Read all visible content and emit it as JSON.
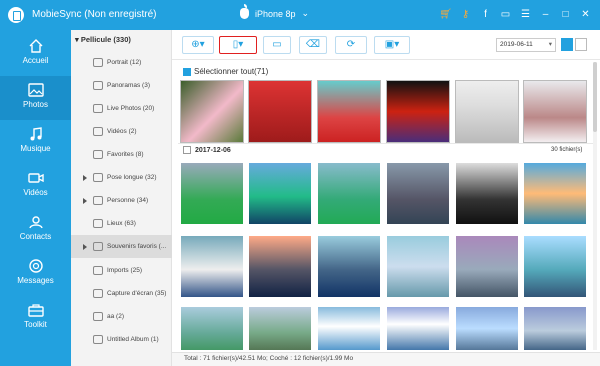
{
  "window": {
    "title": "MobieSync (Non enregistré)",
    "device_name": "iPhone 8p",
    "accent_color": "#22a1df"
  },
  "nav": [
    {
      "label": "Accueil",
      "icon": "home-icon"
    },
    {
      "label": "Photos",
      "icon": "photo-icon",
      "active": true
    },
    {
      "label": "Musique",
      "icon": "music-icon"
    },
    {
      "label": "Vidéos",
      "icon": "video-icon"
    },
    {
      "label": "Contacts",
      "icon": "contacts-icon"
    },
    {
      "label": "Messages",
      "icon": "messages-icon"
    },
    {
      "label": "Toolkit",
      "icon": "toolkit-icon"
    }
  ],
  "albums": {
    "header": "Pellicule (330)",
    "items": [
      {
        "label": "Portrait (12)"
      },
      {
        "label": "Panoramas (3)"
      },
      {
        "label": "Live Photos (20)"
      },
      {
        "label": "Vidéos (2)"
      },
      {
        "label": "Favorites (8)"
      },
      {
        "label": "Pose longue (32)",
        "expandable": true
      },
      {
        "label": "Personne (34)",
        "expandable": true
      },
      {
        "label": "Lieux (63)"
      },
      {
        "label": "Souvenirs favoris (...",
        "expandable": true,
        "selected": true
      },
      {
        "label": "Imports (25)"
      },
      {
        "label": "Capture d'écran (35)"
      },
      {
        "label": "aa (2)"
      },
      {
        "label": "Untitled Album (1)"
      }
    ]
  },
  "toolbar": {
    "add": "add-icon",
    "export_device": "export-to-device-icon",
    "export_pc": "export-to-pc-icon",
    "delete": "delete-icon",
    "refresh": "refresh-icon",
    "toolbox": "toolbox-icon",
    "date_value": "2019-06-11"
  },
  "select_all": {
    "label": "Sélectionner tout(71)"
  },
  "group": {
    "date": "2017-12-06",
    "count": "30 fichier(s)"
  },
  "status": "Total : 71 fichier(s)/42.51 Mo; Coché : 12 fichier(s)/1.99 Mo"
}
